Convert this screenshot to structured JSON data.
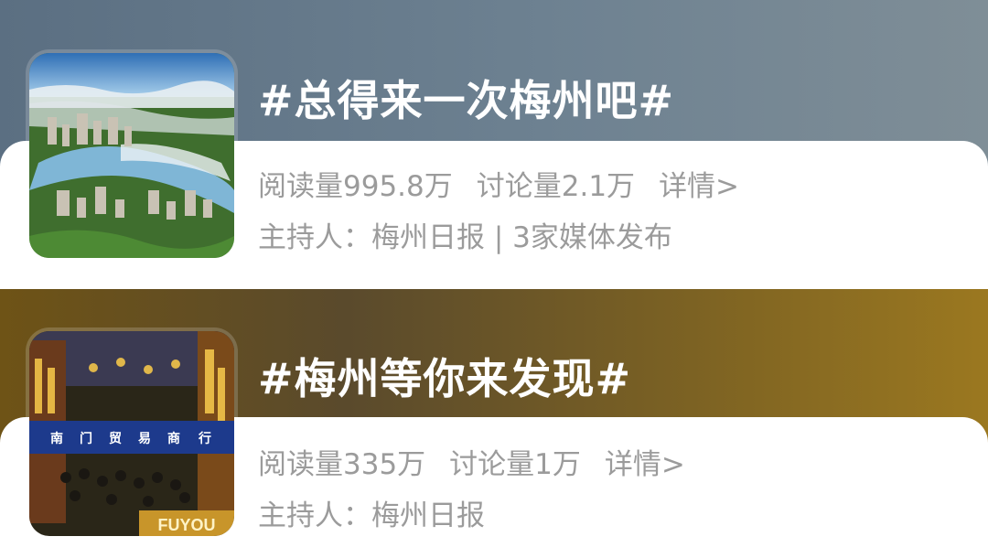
{
  "topics": [
    {
      "title": "#总得来一次梅州吧#",
      "reads": "阅读量995.8万",
      "discussions": "讨论量2.1万",
      "details": "详情>",
      "host": "主持人：梅州日报 | 3家媒体发布"
    },
    {
      "title": "#梅州等你来发现#",
      "reads": "阅读量335万",
      "discussions": "讨论量1万",
      "details": "详情>",
      "host": "主持人：梅州日报"
    }
  ],
  "images": {
    "street_signs": [
      "南",
      "门",
      "贸",
      "易",
      "商",
      "行"
    ],
    "banner_text": "FUYOU"
  }
}
